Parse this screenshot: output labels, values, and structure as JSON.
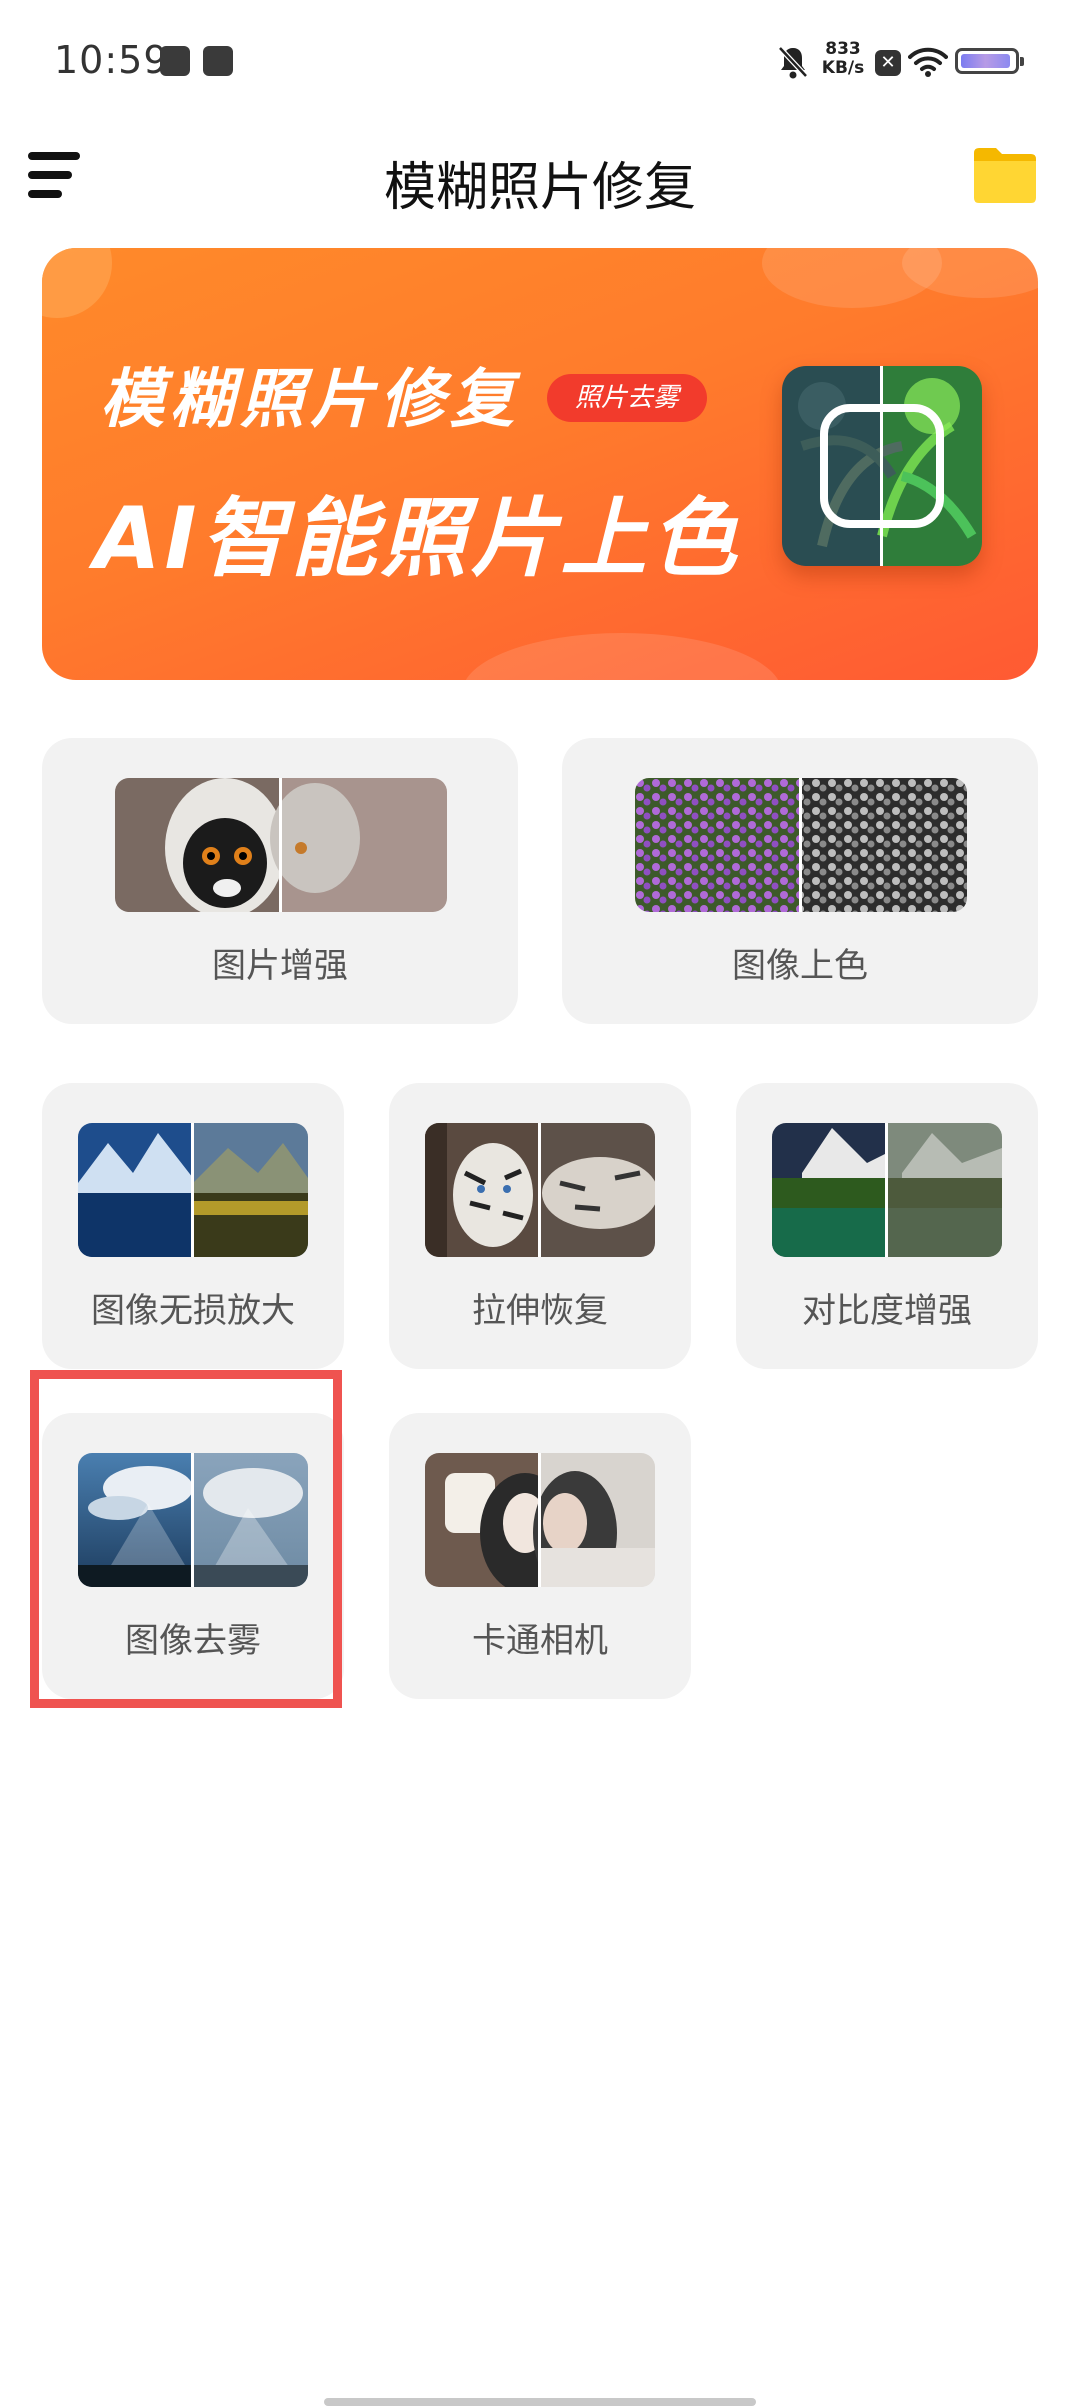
{
  "status_bar": {
    "time": "10:59",
    "net_speed_value": "833",
    "net_speed_unit": "KB/s",
    "battery_level": 0.95,
    "battery_color": "#8c8af0"
  },
  "app_bar": {
    "title": "模糊照片修复",
    "menu_icon": "hamburger-menu-icon",
    "folder_icon": "folder-icon"
  },
  "banner": {
    "line1": "模糊照片修复",
    "tag": "照片去雾",
    "line2": "AI智能照片上色",
    "accent": "#ff7b2c"
  },
  "features": [
    {
      "label": "图片增强"
    },
    {
      "label": "图像上色"
    },
    {
      "label": "图像无损放大"
    },
    {
      "label": "拉伸恢复"
    },
    {
      "label": "对比度增强"
    },
    {
      "label": "图像去雾"
    },
    {
      "label": "卡通相机"
    }
  ],
  "highlight_color": "#ef5350"
}
